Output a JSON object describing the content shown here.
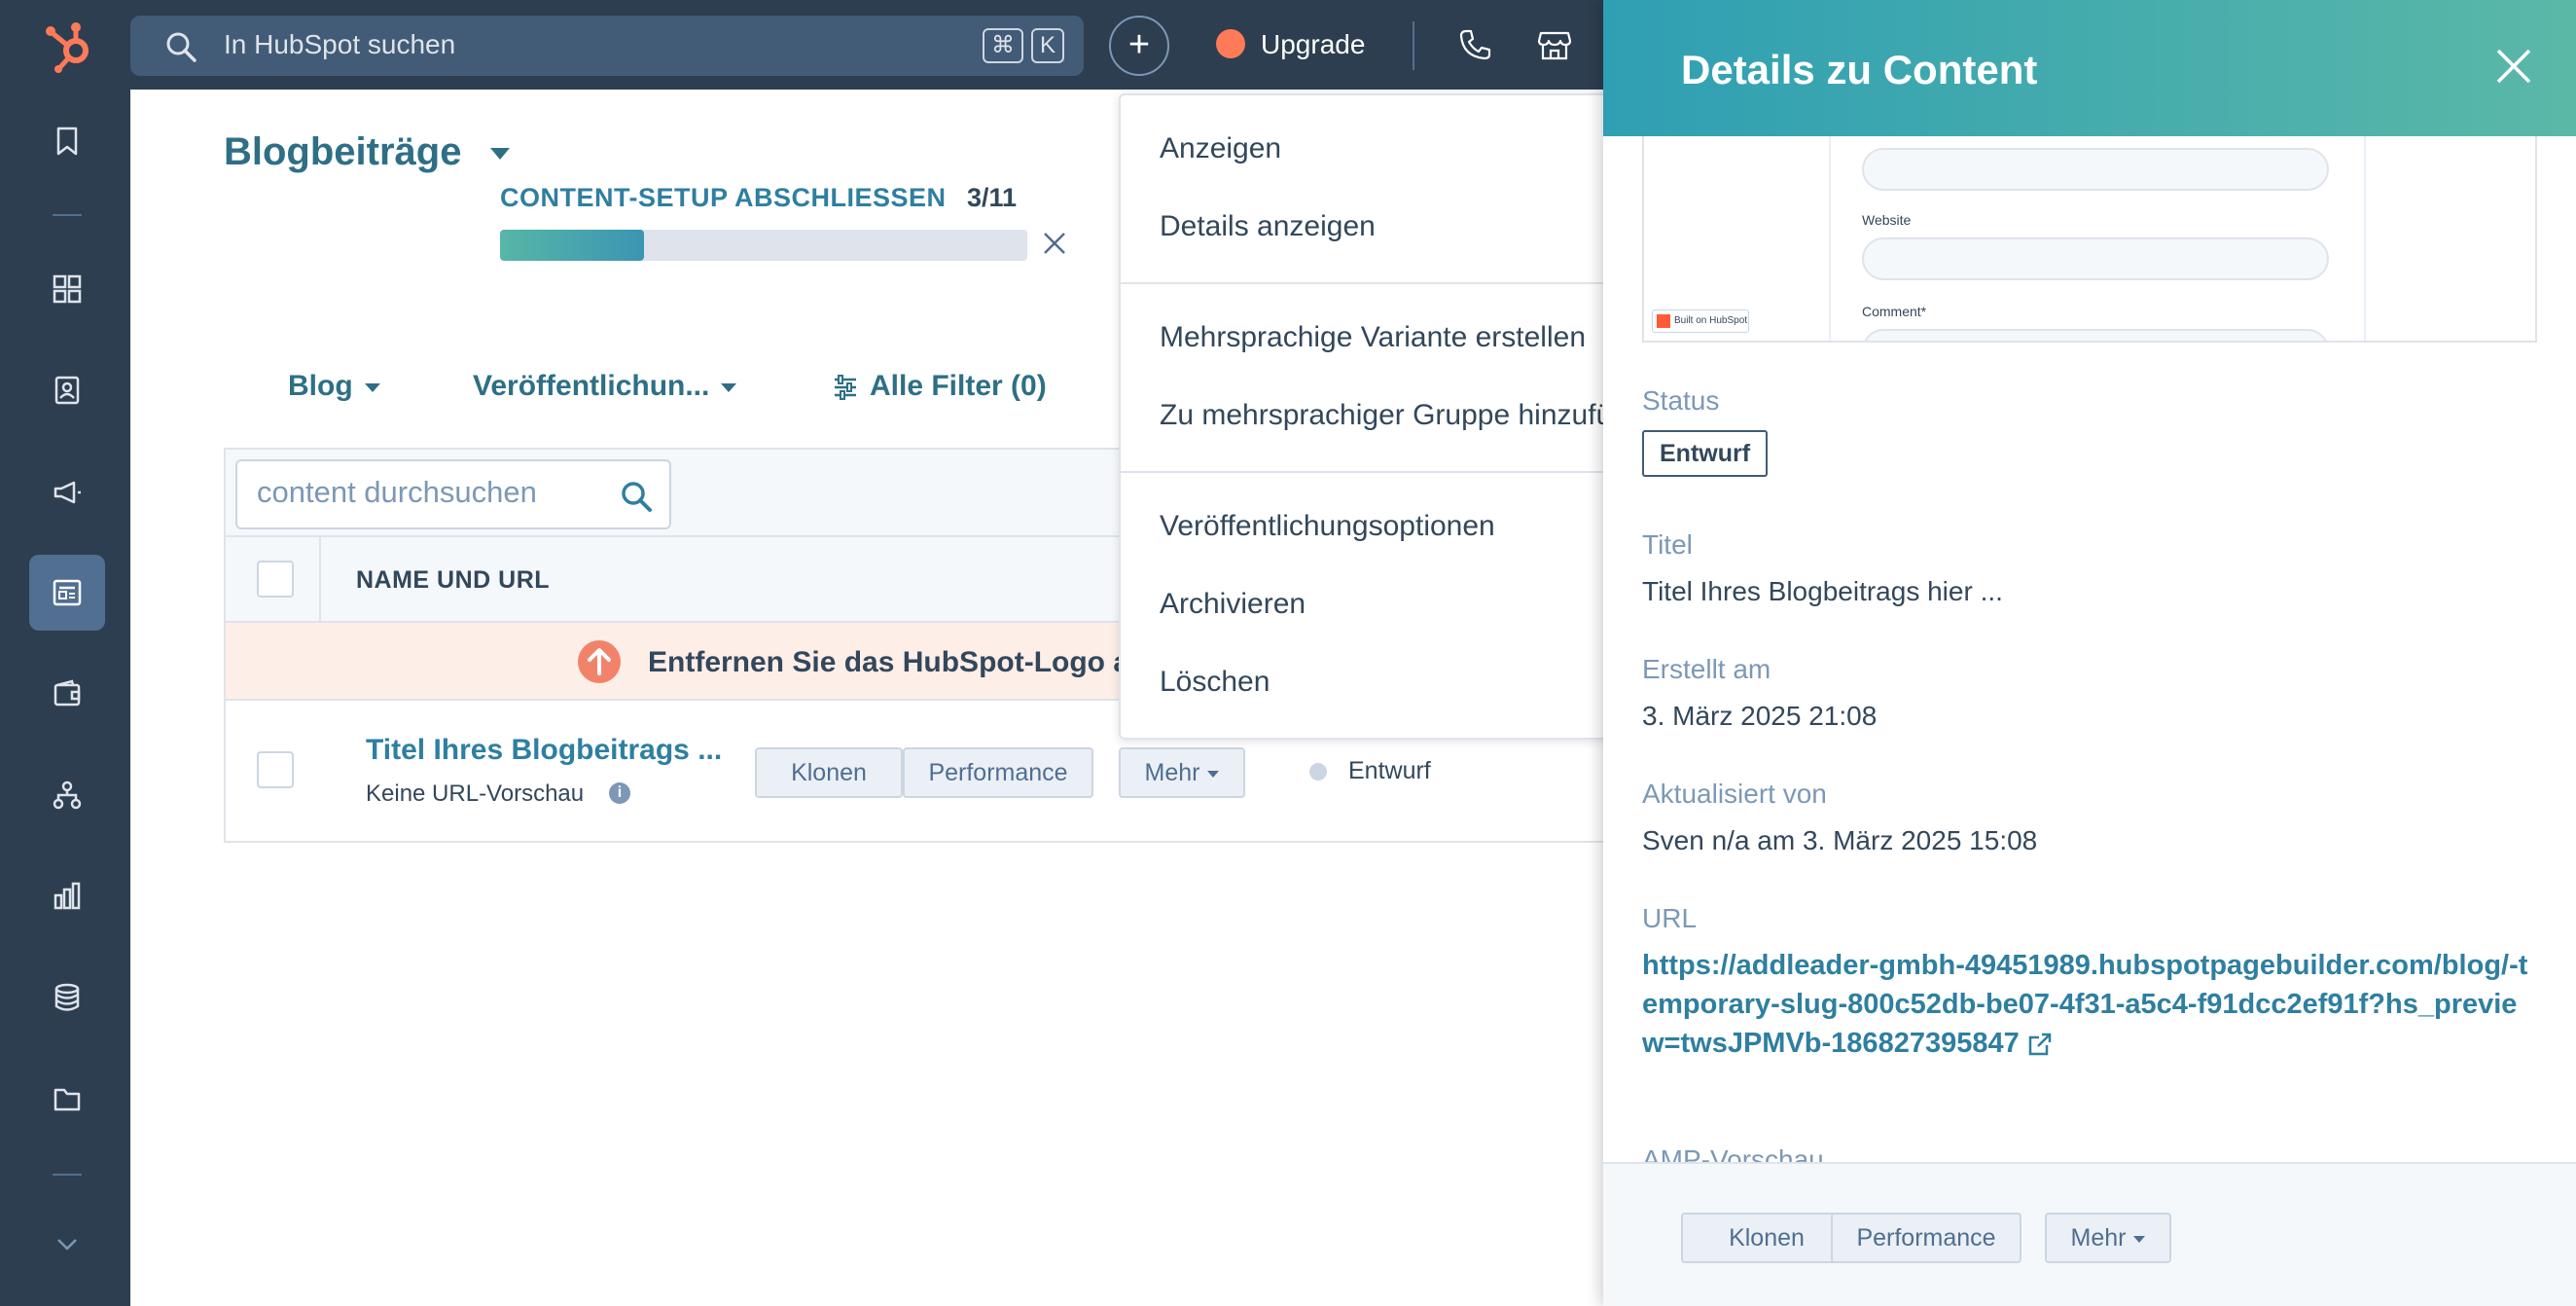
{
  "topbar": {
    "search_placeholder": "In HubSpot suchen",
    "shortcut_cmd": "⌘",
    "shortcut_key": "K",
    "upgrade_label": "Upgrade"
  },
  "page": {
    "title": "Blogbeiträge",
    "setup_label": "CONTENT-SETUP ABSCHLIESSEN",
    "setup_count": "3/11",
    "setup_progress": 0.273
  },
  "filters": {
    "blog": "Blog",
    "publish": "Veröffentlichun...",
    "all": "Alle Filter (0)"
  },
  "table": {
    "search_placeholder": "content durchsuchen",
    "column_name": "NAME UND URL",
    "banner": "Entfernen Sie das HubSpot-Logo a",
    "row": {
      "title": "Titel Ihres Blogbeitrags ...",
      "subtitle": "Keine URL-Vorschau",
      "btn_clone": "Klonen",
      "btn_performance": "Performance",
      "btn_more": "Mehr",
      "status": "Entwurf"
    }
  },
  "menu": {
    "items": [
      "Anzeigen",
      "Details anzeigen",
      "Mehrsprachige Variante erstellen",
      "Zu mehrsprachiger Gruppe hinzufü",
      "Veröffentlichungsoptionen",
      "Archivieren",
      "Löschen"
    ]
  },
  "panel": {
    "title": "Details zu Content",
    "preview": {
      "website_label": "Website",
      "comment_label": "Comment*",
      "badge": "Built on HubSpot"
    },
    "status_label": "Status",
    "status_value": "Entwurf",
    "title_label": "Titel",
    "title_value": "Titel Ihres Blogbeitrags hier ...",
    "created_label": "Erstellt am",
    "created_value": "3. März 2025 21:08",
    "updated_label": "Aktualisiert von",
    "updated_value": "Sven n/a am 3. März 2025 15:08",
    "url_label": "URL",
    "url_value": "https://addleader-gmbh-49451989.hubspotpagebuilder.com/blog/-temporary-slug-800c52db-be07-4f31-a5c4-f91dcc2ef91f?hs_preview=twsJPMVb-186827395847",
    "amp_label": "AMP-Vorschau",
    "btn_clone": "Klonen",
    "btn_performance": "Performance",
    "btn_more": "Mehr"
  },
  "colors": {
    "nav_bg": "#2d3e50",
    "accent_teal": "#2e7fa0",
    "brand_orange": "#ff7a59",
    "panel_header_start": "#2f9fb3",
    "panel_header_end": "#5ab8a7"
  }
}
